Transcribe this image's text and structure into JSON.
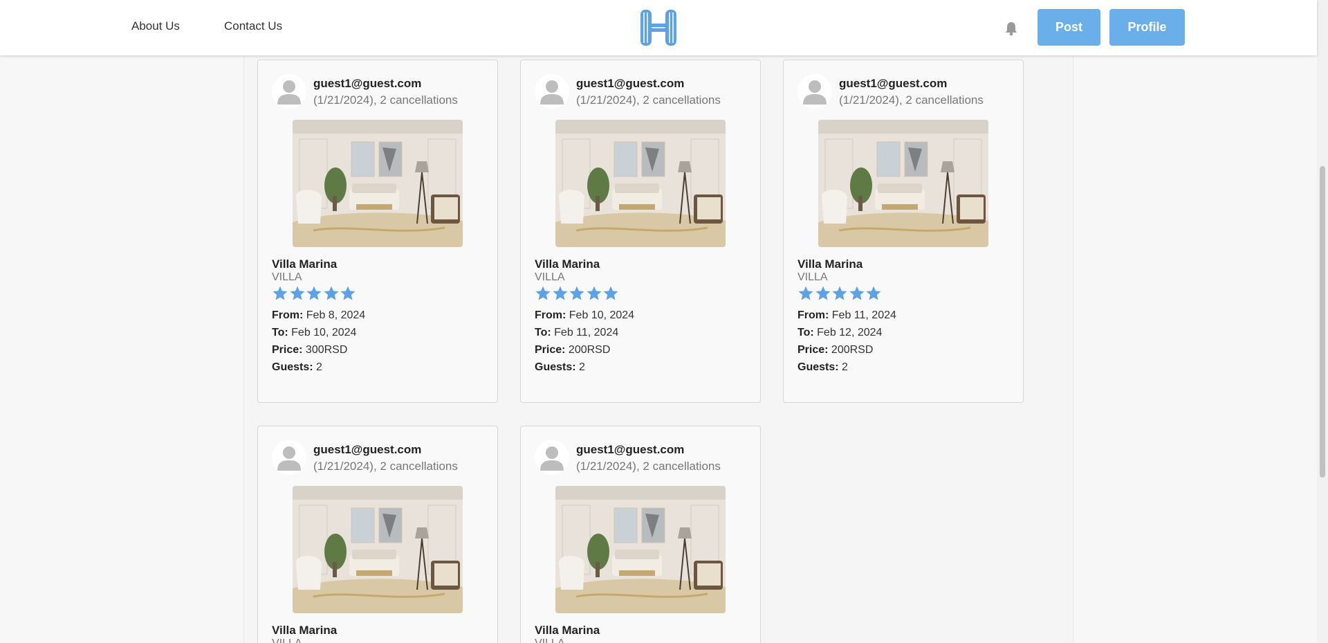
{
  "nav": {
    "about": "About Us",
    "contact": "Contact Us",
    "post": "Post",
    "profile": "Profile"
  },
  "colors": {
    "accent": "#6aaeea",
    "star": "#5ea2e6"
  },
  "icons": [
    "logo-icon",
    "bell-icon",
    "avatar-icon",
    "star-icon"
  ],
  "labels": {
    "from": "From:",
    "to": "To:",
    "price": "Price:",
    "guests": "Guests:"
  },
  "cards": [
    {
      "email": "guest1@guest.com",
      "meta": "(1/21/2024), 2 cancellations",
      "name": "Villa Marina",
      "type": "VILLA",
      "rating": 5,
      "from": "Feb 8, 2024",
      "to": "Feb 10, 2024",
      "price": "300RSD",
      "guests": "2"
    },
    {
      "email": "guest1@guest.com",
      "meta": "(1/21/2024), 2 cancellations",
      "name": "Villa Marina",
      "type": "VILLA",
      "rating": 5,
      "from": "Feb 10, 2024",
      "to": "Feb 11, 2024",
      "price": "200RSD",
      "guests": "2"
    },
    {
      "email": "guest1@guest.com",
      "meta": "(1/21/2024), 2 cancellations",
      "name": "Villa Marina",
      "type": "VILLA",
      "rating": 5,
      "from": "Feb 11, 2024",
      "to": "Feb 12, 2024",
      "price": "200RSD",
      "guests": "2"
    },
    {
      "email": "guest1@guest.com",
      "meta": "(1/21/2024), 2 cancellations",
      "name": "Villa Marina",
      "type": "VILLA"
    },
    {
      "email": "guest1@guest.com",
      "meta": "(1/21/2024), 2 cancellations",
      "name": "Villa Marina",
      "type": "VILLA"
    }
  ]
}
